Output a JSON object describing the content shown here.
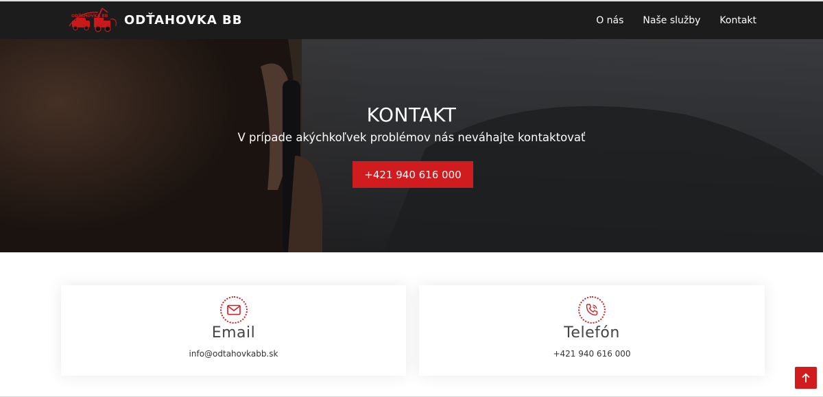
{
  "header": {
    "brand": "ODŤAHOVKA BB",
    "logo_text": "ODŤAHOVKA BB",
    "nav": [
      {
        "label": "O nás"
      },
      {
        "label": "Naše služby"
      },
      {
        "label": "Kontakt"
      }
    ]
  },
  "hero": {
    "title": "KONTAKT",
    "subtitle": "V prípade akýchkoľvek problémov nás neváhajte kontaktovať",
    "button_label": "+421 940 616 000"
  },
  "contacts": [
    {
      "title": "Email",
      "value": "info@odtahovkabb.sk",
      "icon": "envelope-icon"
    },
    {
      "title": "Telefón",
      "value": "+421 940 616 000",
      "icon": "phone-icon"
    }
  ],
  "colors": {
    "accent": "#d01c1f",
    "navbar": "#1c1c1c"
  },
  "back_to_top": {
    "icon": "arrow-up-icon"
  }
}
